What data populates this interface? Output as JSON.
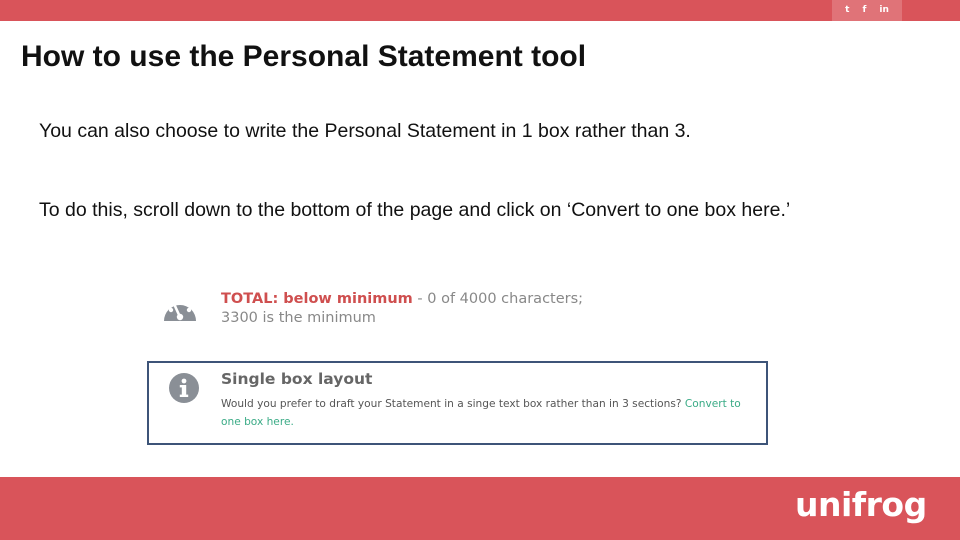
{
  "header": {
    "social_icons": [
      {
        "name": "twitter-icon",
        "glyph": "🐦",
        "display": "t"
      },
      {
        "name": "facebook-icon",
        "display": "f"
      },
      {
        "name": "linkedin-icon",
        "display": "in"
      }
    ]
  },
  "slide": {
    "title": "How to use the Personal Statement tool",
    "paragraph1": "You can also choose to write the Personal Statement in 1 box rather than 3.",
    "paragraph2": "To do this, scroll down to the bottom of the page and click on ‘Convert to one box here.’"
  },
  "screenshot": {
    "total": {
      "status": "TOTAL: below minimum",
      "count": " - 0 of 4000 characters;",
      "minimum": "3300 is the minimum"
    },
    "single_box": {
      "heading": "Single box layout",
      "text": "Would you prefer to draft your Statement in a singe text box rather than in 3 sections? ",
      "link": "Convert to one box here."
    }
  },
  "footer": {
    "logo": "unifrog"
  },
  "colors": {
    "brand_red": "#d9545a",
    "box_border": "#3d5478",
    "link_green": "#3aab86",
    "status_red": "#cf4f4f"
  }
}
